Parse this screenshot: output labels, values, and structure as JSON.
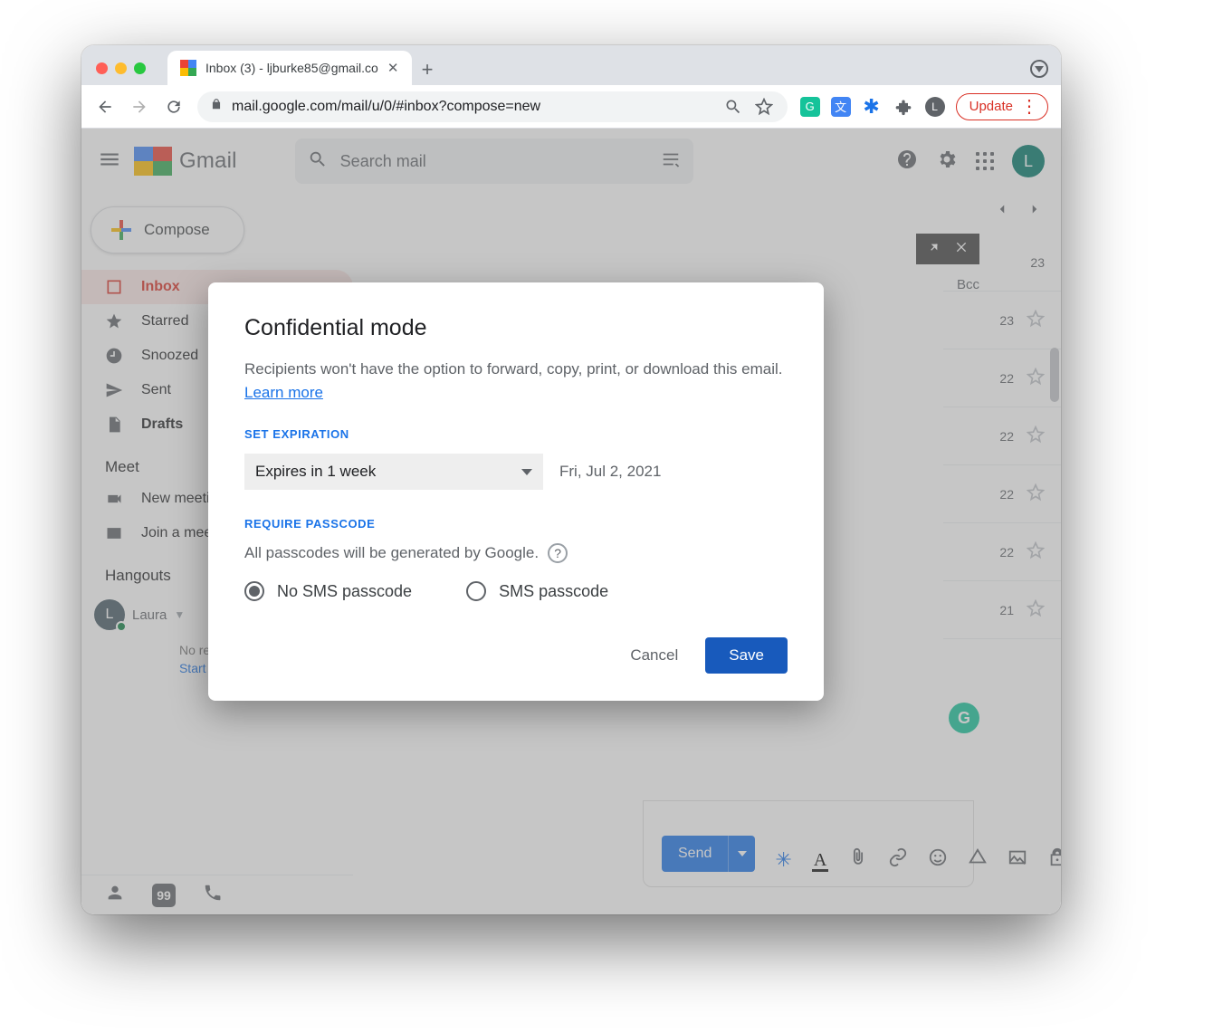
{
  "browser": {
    "tab_title": "Inbox (3) - ljburke85@gmail.co",
    "url": "mail.google.com/mail/u/0/#inbox?compose=new",
    "update_label": "Update",
    "avatar_initial": "L"
  },
  "header": {
    "brand": "Gmail",
    "search_placeholder": "Search mail",
    "avatar_initial": "L"
  },
  "sidebar": {
    "compose_label": "Compose",
    "items": [
      {
        "label": "Inbox"
      },
      {
        "label": "Starred"
      },
      {
        "label": "Snoozed"
      },
      {
        "label": "Sent"
      },
      {
        "label": "Drafts"
      }
    ],
    "meet_header": "Meet",
    "meet_items": [
      {
        "label": "New meeting"
      },
      {
        "label": "Join a meeting"
      }
    ],
    "hangouts_header": "Hangouts",
    "hangouts_user": "Laura",
    "hangouts_initial": "L",
    "no_chats": "No recent chats",
    "start_new": "Start a new one"
  },
  "mail": {
    "bcc_label": "Bcc",
    "row_dates": [
      "23",
      "23",
      "22",
      "22",
      "22",
      "22",
      "21"
    ],
    "grammarly_initial": "G"
  },
  "compose": {
    "send_label": "Send"
  },
  "modal": {
    "title": "Confidential mode",
    "desc_text": "Recipients won't have the option to forward, copy, print, or download this email. ",
    "learn_more": "Learn more",
    "expiration_header": "SET EXPIRATION",
    "expiration_value": "Expires in 1 week",
    "expiration_date": "Fri, Jul 2, 2021",
    "passcode_header": "REQUIRE PASSCODE",
    "passcode_sub": "All passcodes will be generated by Google.",
    "radio_no_sms": "No SMS passcode",
    "radio_sms": "SMS passcode",
    "cancel": "Cancel",
    "save": "Save"
  }
}
